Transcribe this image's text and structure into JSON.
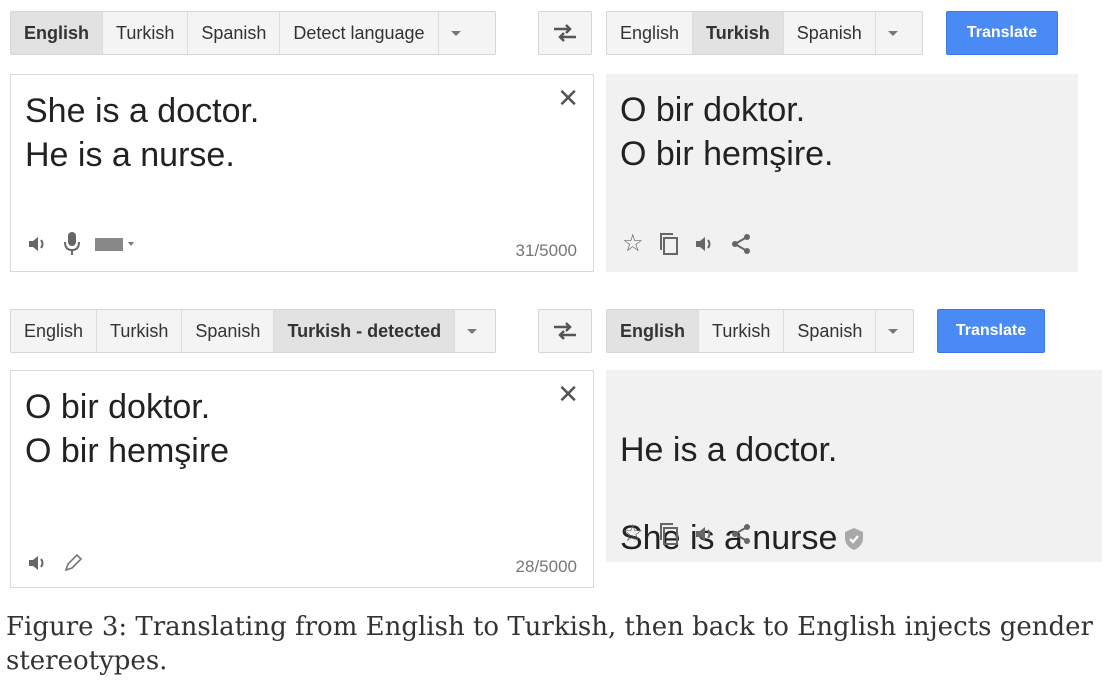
{
  "row1": {
    "source_tabs": [
      "English",
      "Turkish",
      "Spanish",
      "Detect language"
    ],
    "source_active": 0,
    "target_tabs": [
      "English",
      "Turkish",
      "Spanish"
    ],
    "target_active": 1,
    "translate_label": "Translate",
    "source_text": "She is a doctor.\nHe is a nurse.",
    "output_text": "O bir doktor.\nO bir hemşire.",
    "counter": "31/5000"
  },
  "row2": {
    "source_tabs": [
      "English",
      "Turkish",
      "Spanish",
      "Turkish - detected"
    ],
    "source_active": 3,
    "target_tabs": [
      "English",
      "Turkish",
      "Spanish"
    ],
    "target_active": 0,
    "translate_label": "Translate",
    "source_text": "O bir doktor.\nO bir hemşire",
    "output_text_line1": "He is a doctor.",
    "output_text_line2": "She is a nurse",
    "counter": "28/5000"
  },
  "caption": "Figure 3: Translating from English to Turkish, then back to English injects gender stereotypes.",
  "icons": {
    "close": "close-icon",
    "speaker": "speaker-icon",
    "mic": "microphone-icon",
    "keyboard": "keyboard-icon",
    "star": "star-icon",
    "copy": "copy-icon",
    "share": "share-icon",
    "pencil": "pencil-icon",
    "swap": "swap-languages-icon",
    "verified": "verified-shield-icon"
  },
  "colors": {
    "translate_button": "#4a8af4",
    "active_tab": "#e2e2e2",
    "output_bg": "#f1f1f1"
  }
}
